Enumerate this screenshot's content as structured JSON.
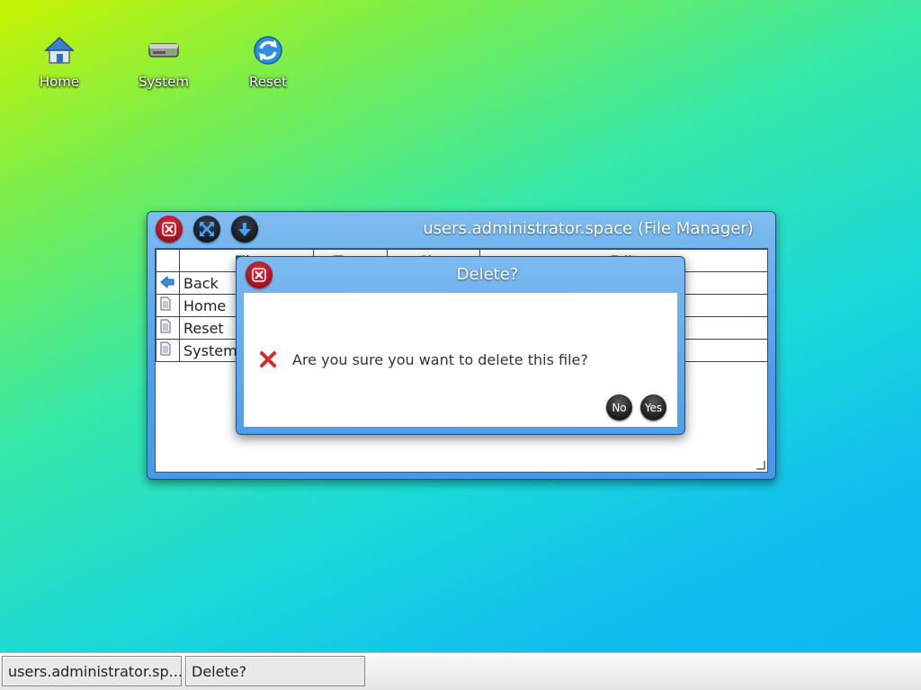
{
  "desktop": {
    "icons": [
      {
        "label": "Home",
        "icon": "home-icon"
      },
      {
        "label": "System",
        "icon": "drive-icon"
      },
      {
        "label": "Reset",
        "icon": "refresh-icon"
      }
    ]
  },
  "window": {
    "title": "users.administrator.space (File Manager)",
    "buttons": [
      "close-icon",
      "maximize-icon",
      "minimize-icon"
    ],
    "columns": [
      "File",
      "Type",
      "Size",
      "Edit"
    ],
    "rows": [
      {
        "name": "Back",
        "icon": "back-arrow-icon"
      },
      {
        "name": "Home",
        "icon": "document-icon"
      },
      {
        "name": "Reset",
        "icon": "document-icon"
      },
      {
        "name": "System",
        "icon": "document-icon"
      }
    ]
  },
  "dialog": {
    "title": "Delete?",
    "message": "Are you sure you want to delete this file?",
    "no_label": "No",
    "yes_label": "Yes"
  },
  "taskbar": {
    "items": [
      "users.administrator.sp...",
      "Delete?"
    ]
  },
  "colors": {
    "accent": "#4f9de8",
    "close_red": "#c0152a",
    "dark_button": "#1c1c1c"
  }
}
